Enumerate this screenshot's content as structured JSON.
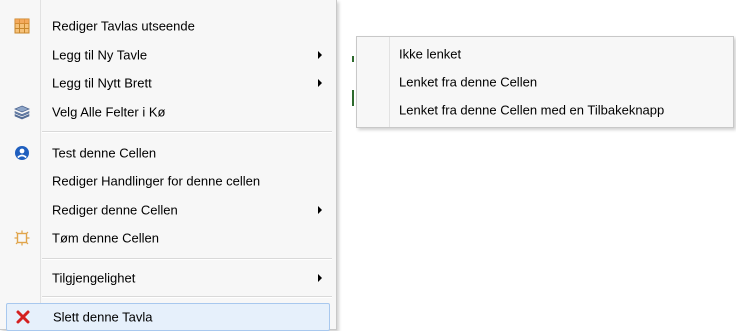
{
  "main_menu": {
    "items": [
      {
        "label": "Rediger Tavlas utseende",
        "icon": "grid-table-icon"
      },
      {
        "label": "Legg til Ny Tavle",
        "has_submenu": true
      },
      {
        "label": "Legg til Nytt Brett",
        "has_submenu": true
      },
      {
        "label": "Velg Alle Felter i Kø",
        "icon": "stack-icon"
      },
      {
        "label": "Test denne Cellen",
        "icon": "blue-circle-icon"
      },
      {
        "label": "Rediger Handlinger for denne cellen"
      },
      {
        "label": "Rediger denne Cellen",
        "has_submenu": true
      },
      {
        "label": "Tøm denne Cellen",
        "icon": "clear-burst-icon"
      },
      {
        "label": "Tilgjengelighet",
        "has_submenu": true
      },
      {
        "label": "Slett denne Tavla",
        "icon": "red-x-icon",
        "highlighted": true
      }
    ]
  },
  "sub_menu": {
    "items": [
      {
        "label": "Ikke lenket"
      },
      {
        "label": "Lenket fra denne Cellen"
      },
      {
        "label": "Lenket fra denne Cellen med en Tilbakeknapp"
      }
    ]
  },
  "colors": {
    "menu_bg": "#f7f7f7",
    "highlight_bg": "#e6f0fb",
    "highlight_border": "#a8c8ee",
    "delete_red": "#d42020",
    "test_blue": "#1f5fbf"
  }
}
